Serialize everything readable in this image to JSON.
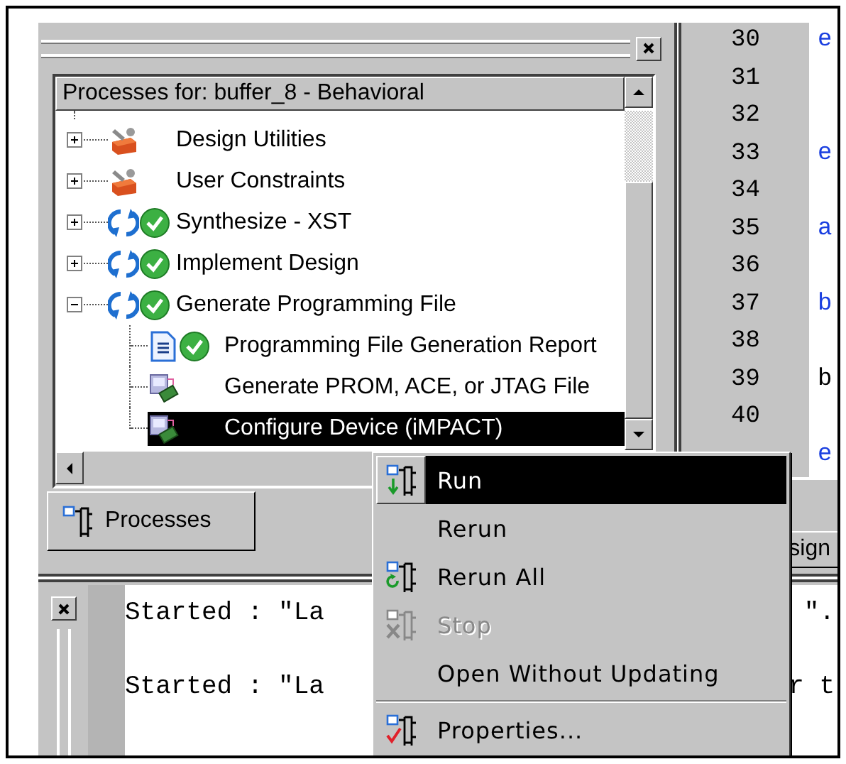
{
  "process_pane": {
    "header": "Processes for: buffer_8 - Behavioral",
    "tree": [
      {
        "label": "Design Utilities",
        "kind": "tools",
        "done": false,
        "expanded": false,
        "selected": false
      },
      {
        "label": "User Constraints",
        "kind": "tools",
        "done": false,
        "expanded": false,
        "selected": false
      },
      {
        "label": "Synthesize - XST",
        "kind": "process",
        "done": true,
        "expanded": false,
        "selected": false
      },
      {
        "label": "Implement Design",
        "kind": "process",
        "done": true,
        "expanded": false,
        "selected": false
      },
      {
        "label": "Generate Programming File",
        "kind": "process",
        "done": true,
        "expanded": true,
        "selected": false,
        "children": [
          {
            "label": "Programming File Generation Report",
            "kind": "report",
            "done": true,
            "selected": false
          },
          {
            "label": "Generate PROM, ACE, or JTAG File",
            "kind": "device",
            "done": false,
            "selected": false
          },
          {
            "label": "Configure Device (iMPACT)",
            "kind": "device",
            "done": false,
            "selected": true
          }
        ]
      }
    ],
    "tab": {
      "label": "Processes"
    }
  },
  "editor": {
    "lines": [
      {
        "number": "30",
        "text": "e",
        "kind": "keyword"
      },
      {
        "number": "31"
      },
      {
        "number": "32"
      },
      {
        "number": "33",
        "text": "e",
        "kind": "keyword"
      },
      {
        "number": "34"
      },
      {
        "number": "35",
        "text": "a",
        "kind": "keyword"
      },
      {
        "number": "36"
      },
      {
        "number": "37",
        "text": "b",
        "kind": "keyword"
      },
      {
        "number": "38"
      },
      {
        "number": "39",
        "text": "b",
        "kind": "plain"
      },
      {
        "number": "40"
      },
      {
        "text": "e",
        "kind": "keyword"
      }
    ]
  },
  "design_tab": {
    "label": "sign"
  },
  "console": {
    "lines": [
      {
        "text": "Started : \"La",
        "tail": "\"."
      },
      {
        "text": "Started : \"La",
        "tail": "r t"
      }
    ]
  },
  "context_menu": {
    "items": [
      {
        "label": "Run",
        "kind": "run",
        "selected": true,
        "disabled": false
      },
      {
        "label": "Rerun",
        "kind": "plain",
        "selected": false,
        "disabled": false
      },
      {
        "label": "Rerun All",
        "kind": "rerun-all",
        "selected": false,
        "disabled": false
      },
      {
        "label": "Stop",
        "kind": "stop",
        "selected": false,
        "disabled": true
      },
      {
        "label": "Open Without Updating",
        "kind": "plain",
        "selected": false,
        "disabled": false,
        "separator_after": true
      },
      {
        "label": "Properties...",
        "kind": "properties",
        "selected": false,
        "disabled": false
      }
    ]
  }
}
